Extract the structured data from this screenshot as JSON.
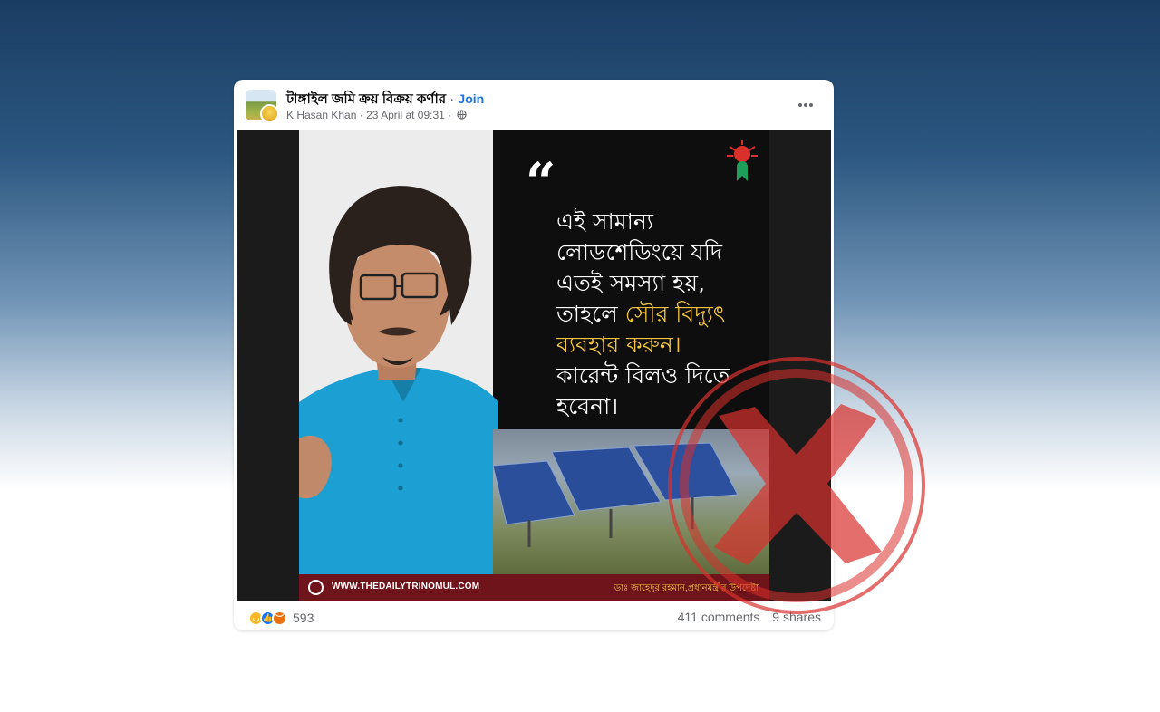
{
  "post": {
    "group_name": "টাঙ্গাইল জমি ক্রয় বিক্রয় কর্ণার",
    "separator": "·",
    "join_label": "Join",
    "author": "K Hasan Khan",
    "date": "23 April at 09:31",
    "meta_separator": "·",
    "privacy_icon": "globe-icon",
    "more_icon": "more-options-icon"
  },
  "poster": {
    "quote_mark": "“",
    "quote_lines_plain_1": "এই সামান্য",
    "quote_lines_plain_2": "লোডশেডিংয়ে যদি",
    "quote_lines_plain_3": "এতই সমস্যা হয়,",
    "quote_line4_prefix": "তাহলে ",
    "quote_line4_highlight": "সৌর বিদ্যুৎ",
    "quote_line5_highlight": "ব্যবহার করুন।",
    "quote_lines_plain_6": "কারেন্ট বিলও দিতে",
    "quote_lines_plain_7": "হবেনা।",
    "website": "WWW.THEDAILYTRINOMUL.COM",
    "credit": "ডাঃ জাহেদুর রহমান,প্রধানমন্ত্রীর উপদেষ্টা",
    "highlight_color": "#f4c542",
    "footer_color": "#6f141a"
  },
  "engagement": {
    "reaction_icons": [
      "haha-icon",
      "like-icon",
      "angry-icon"
    ],
    "reaction_count": "593",
    "comments": "411 comments",
    "shares": "9 shares"
  },
  "overlay": {
    "stamp": "fake-cross-stamp",
    "color": "#d9302c"
  }
}
